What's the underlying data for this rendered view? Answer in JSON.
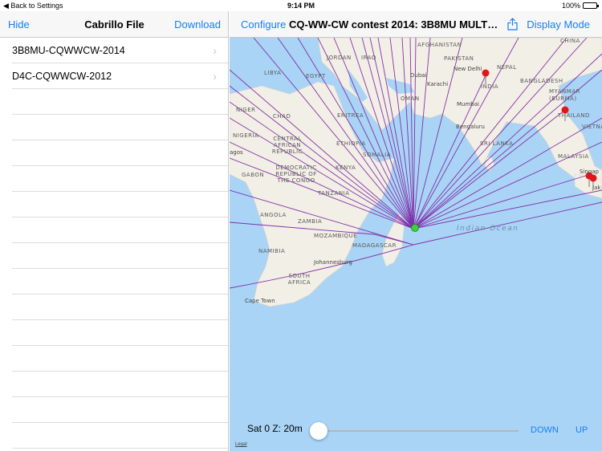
{
  "status_bar": {
    "back_label": "Back to Settings",
    "time": "9:14 PM",
    "battery": "100%"
  },
  "left_pane": {
    "hide_label": "Hide",
    "title": "Cabrillo File",
    "download_label": "Download",
    "files": [
      {
        "name": "3B8MU-CQWWCW-2014"
      },
      {
        "name": "D4C-CQWWCW-2012"
      }
    ]
  },
  "right_pane": {
    "configure_label": "Configure",
    "title": "CQ-WW-CW contest 2014: 3B8MU MULTI…",
    "display_mode_label": "Display Mode",
    "share_icon": "share-icon"
  },
  "map": {
    "labels": {
      "china": "CHINA",
      "afghanistan": "AFGHANISTAN",
      "pakistan": "PAKISTAN",
      "new_delhi": "New Delhi",
      "nepal": "NEPAL",
      "jordan": "JORDAN",
      "iraq": "IRAQ",
      "libya": "LIBYA",
      "egypt": "EGYPT",
      "dubai": "Dubai",
      "karachi": "Karachi",
      "bangladesh": "BANGLADESH",
      "oman": "OMAN",
      "india": "INDIA",
      "myanmar": "MYANMAR (BURMA)",
      "niger": "NIGER",
      "chad": "CHAD",
      "eritrea": "ERITREA",
      "mumbai": "Mumbai",
      "thailand": "THAILAND",
      "vietnam": "VIETNA",
      "nigeria": "NIGERIA",
      "central_african_republic": "CENTRAL AFRICAN REPUBLIC",
      "ethiopia": "ETHIOPIA",
      "bengaluru": "Bengaluru",
      "sri_lanka": "SRI LANKA",
      "lagos": "agos",
      "somalia": "SOMALIA",
      "malaysia": "MALAYSIA",
      "gabon": "GABON",
      "drc": "DEMOCRATIC REPUBLIC OF THE CONGO",
      "kenya": "KENYA",
      "singapore": "Singap",
      "tanzania": "TANZANIA",
      "jakarta": "Jak",
      "angola": "ANGOLA",
      "zambia": "ZAMBIA",
      "indian_ocean": "Indian Ocean",
      "mozambique": "MOZAMBIQUE",
      "madagascar": "MADAGASCAR",
      "namibia": "NAMIBIA",
      "johannesburg": "Johannesburg",
      "south_africa": "SOUTH AFRICA",
      "cape_town": "Cape Town"
    },
    "legal": "Legal"
  },
  "controls": {
    "sat_label": "Sat 0 Z: 20m",
    "slider_value": 0,
    "down_label": "DOWN",
    "up_label": "UP"
  },
  "colors": {
    "accent": "#157efb",
    "path_line": "#7b1fa2",
    "ocean": "#a9d4f5",
    "land": "#f2efe6",
    "origin_marker": "#3ecf3e",
    "pin": "#e0161b"
  }
}
